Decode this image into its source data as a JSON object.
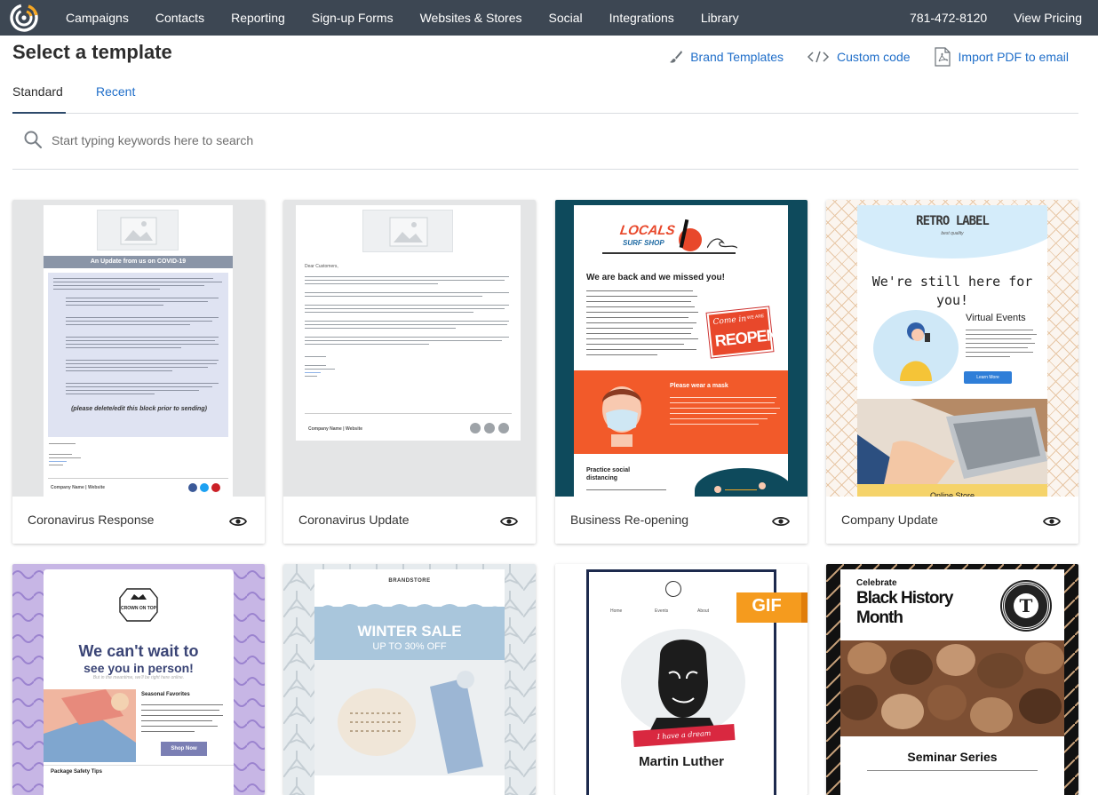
{
  "nav": {
    "items": [
      "Campaigns",
      "Contacts",
      "Reporting",
      "Sign-up Forms",
      "Websites & Stores",
      "Social",
      "Integrations",
      "Library"
    ],
    "phone": "781-472-8120",
    "pricing": "View Pricing"
  },
  "header": {
    "title": "Select a template",
    "actions": {
      "brand_templates": "Brand Templates",
      "custom_code": "Custom code",
      "import_pdf": "Import PDF to email"
    }
  },
  "tabs": {
    "standard": "Standard",
    "recent": "Recent"
  },
  "search": {
    "placeholder": "Start typing keywords here to search"
  },
  "templates": [
    {
      "name": "Coronavirus Response",
      "preview": {
        "heading": "An Update from us on COVID-19",
        "closing": "(please delete/edit this block prior to sending)",
        "footer": "Company Name | Website"
      }
    },
    {
      "name": "Coronavirus Update",
      "preview": {
        "greeting": "Dear Customers,",
        "footer": "Company Name | Website"
      }
    },
    {
      "name": "Business Re-opening",
      "preview": {
        "logo_top": "LOCALS",
        "logo_bottom": "SURF SHOP",
        "heading": "We are back and we missed you!",
        "sign_1": "Come in",
        "sign_2": "WE ARE",
        "sign_3": "REOPEN",
        "mask": "Please wear a mask",
        "distancing": "Practice social distancing"
      }
    },
    {
      "name": "Company Update",
      "preview": {
        "logo": "RETRO LABEL",
        "logo_sub": "best quality",
        "heading": "We're still here for you!",
        "sub": "Virtual Events",
        "button": "Learn More",
        "bottom": "Online Store"
      }
    },
    {
      "name": "",
      "preview": {
        "logo": "CROWN ON TOP",
        "heading_1": "We can't wait to",
        "heading_2": "see you in person!",
        "tagline": "But in the meantime, we'll be right here online.",
        "section": "Seasonal Favorites",
        "button": "Shop Now",
        "bottom": "Package Safety Tips"
      }
    },
    {
      "name": "",
      "preview": {
        "logo": "BRANDSTORE",
        "heading": "WINTER SALE",
        "sub": "UP TO 30% OFF"
      }
    },
    {
      "name": "",
      "preview": {
        "nav": [
          "Home",
          "Events",
          "About"
        ],
        "badge": "GIF",
        "ribbon": "I have a dream",
        "title": "Martin Luther"
      }
    },
    {
      "name": "",
      "preview": {
        "pre": "Celebrate",
        "title_1": "Black History",
        "title_2": "Month",
        "seal": "T",
        "footer": "Seminar Series"
      }
    }
  ],
  "colors": {
    "nav_bg": "#3d4753",
    "accent": "#1f6ec9",
    "logo": "#f5a623",
    "surf_navy": "#0e4a5c",
    "surf_orange": "#f25a2a"
  }
}
